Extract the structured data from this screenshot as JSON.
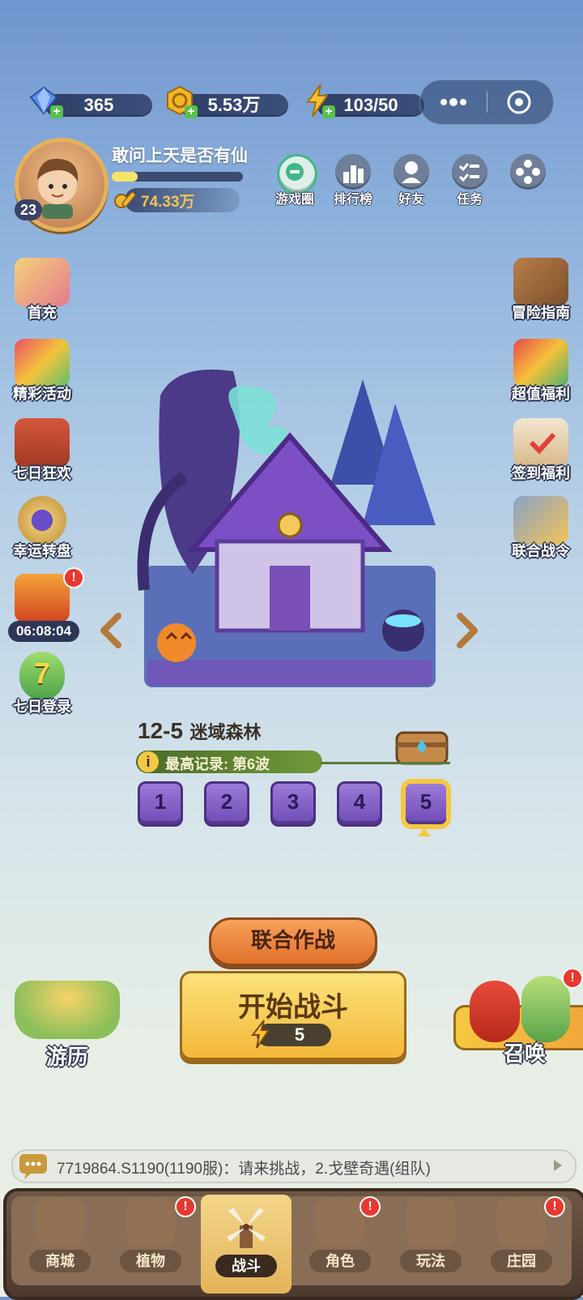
{
  "resources": {
    "gems": "365",
    "coins": "5.53万",
    "energy": "103/50"
  },
  "mini_program": {
    "more_icon": "more-dots-icon",
    "close_icon": "target-circle-icon"
  },
  "player": {
    "name": "敢问上天是否有仙",
    "level": "23",
    "power": "74.33万",
    "exp_progress": 0.2
  },
  "top_icons": [
    {
      "label": "游戏圈",
      "icon": "game-circle-icon"
    },
    {
      "label": "排行榜",
      "icon": "ranking-icon"
    },
    {
      "label": "好友",
      "icon": "friends-icon"
    },
    {
      "label": "任务",
      "icon": "task-icon"
    },
    {
      "label": "",
      "icon": "settings-icon"
    }
  ],
  "left_menu": [
    {
      "label": "首充"
    },
    {
      "label": "精彩活动"
    },
    {
      "label": "七日狂欢"
    },
    {
      "label": "幸运转盘"
    },
    {
      "label": "06:08:04"
    },
    {
      "label": "七日登录"
    }
  ],
  "right_menu": [
    {
      "label": "冒险指南"
    },
    {
      "label": "超值福利"
    },
    {
      "label": "签到福利"
    },
    {
      "label": "联合战令"
    }
  ],
  "stage": {
    "code": "12-5",
    "name": "迷域森林",
    "record": "最高记录: 第6波",
    "levels": [
      "1",
      "2",
      "3",
      "4",
      "5"
    ],
    "selected": "5"
  },
  "buttons": {
    "joint_battle": "联合作战",
    "start_battle": "开始战斗",
    "energy_cost": "5",
    "travel": "游历",
    "summon": "召唤"
  },
  "chat": {
    "message": "7719864.S1190(1190服)：请来挑战，2.戈壁奇遇(组队)"
  },
  "nav_tabs": [
    {
      "label": "商城",
      "badge": ""
    },
    {
      "label": "植物",
      "badge": "!"
    },
    {
      "label": "战斗",
      "badge": ""
    },
    {
      "label": "角色",
      "badge": "!"
    },
    {
      "label": "玩法",
      "badge": ""
    },
    {
      "label": "庄园",
      "badge": "!"
    }
  ],
  "colors": {
    "accent_orange": "#f08a3a",
    "start_yellow": "#f7c94a",
    "stage_purple": "#7b52c7",
    "badge_red": "#e8382f"
  }
}
